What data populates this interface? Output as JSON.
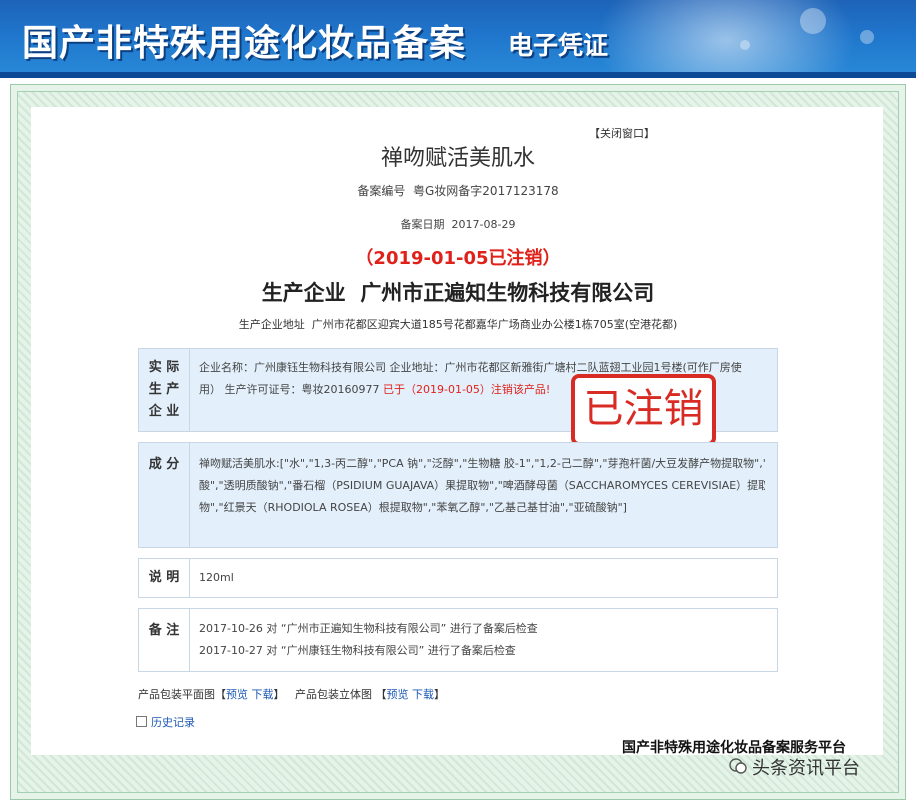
{
  "banner": {
    "title": "国产非特殊用途化妆品备案",
    "subtitle": "电子凭证"
  },
  "close_window": "【关闭窗口】",
  "product": {
    "name": "禅吻赋活美肌水",
    "record_no_label": "备案编号",
    "record_no": "粤G妆网备字2017123178",
    "record_date_label": "备案日期",
    "record_date": "2017-08-29",
    "cancel_notice": "（2019-01-05已注销）",
    "producer_label": "生产企业",
    "producer": "广州市正遍知生物科技有限公司",
    "producer_addr_label": "生产企业地址",
    "producer_addr": "广州市花都区迎宾大道185号花都嘉华广场商业办公楼1栋705室(空港花都)"
  },
  "actual_producer": {
    "label_lines": [
      "实 际",
      "生 产",
      "企 业"
    ],
    "line1": "企业名称：广州康钰生物科技有限公司  企业地址：广州市花都区新雅街广塘村二队蓝翅工业园1号楼(可作厂房使",
    "line2_prefix": "用）  生产许可证号：粤妆20160977  ",
    "line2_red": "已于（2019-01-05）注销该产品!"
  },
  "stamp": "已注销",
  "ingredients": {
    "label": "成 分",
    "lines": [
      "禅吻赋活美肌水:[\"水\",\"1,3-丙二醇\",\"PCA 钠\",\"泛醇\",\"生物糖 胶-1\",\"1,2-己二醇\",\"芽孢杆菌/大豆发酵产物提取物\",\"叶",
      "酸\",\"透明质酸钠\",\"番石榴（PSIDIUM GUAJAVA）果提取物\",\"啤酒酵母菌（SACCHAROMYCES CEREVISIAE）提取",
      "物\",\"红景天（RHODIOLA ROSEA）根提取物\",\"苯氧乙醇\",\"乙基己基甘油\",\"亚硫酸钠\"]"
    ]
  },
  "spec": {
    "label": "说 明",
    "value": "120ml"
  },
  "remarks": {
    "label": "备 注",
    "lines": [
      "2017-10-26 对 “广州市正遍知生物科技有限公司” 进行了备案后检查",
      "2017-10-27 对 “广州康钰生物科技有限公司” 进行了备案后检查"
    ]
  },
  "downloads": {
    "flat_label": "产品包装平面图",
    "preview": "预览",
    "download": "下载",
    "solid_label": "产品包装立体图"
  },
  "history": "历史记录",
  "platform": "国产非特殊用途化妆品备案服务平台",
  "watermark": "头条资讯平台",
  "colors": {
    "banner_blue": "#1f76cc",
    "cancel_red": "#e0211a",
    "link_blue": "#1c58b5",
    "box_blue": "#e3f0fb",
    "frame_green": "#e5f3e8"
  }
}
